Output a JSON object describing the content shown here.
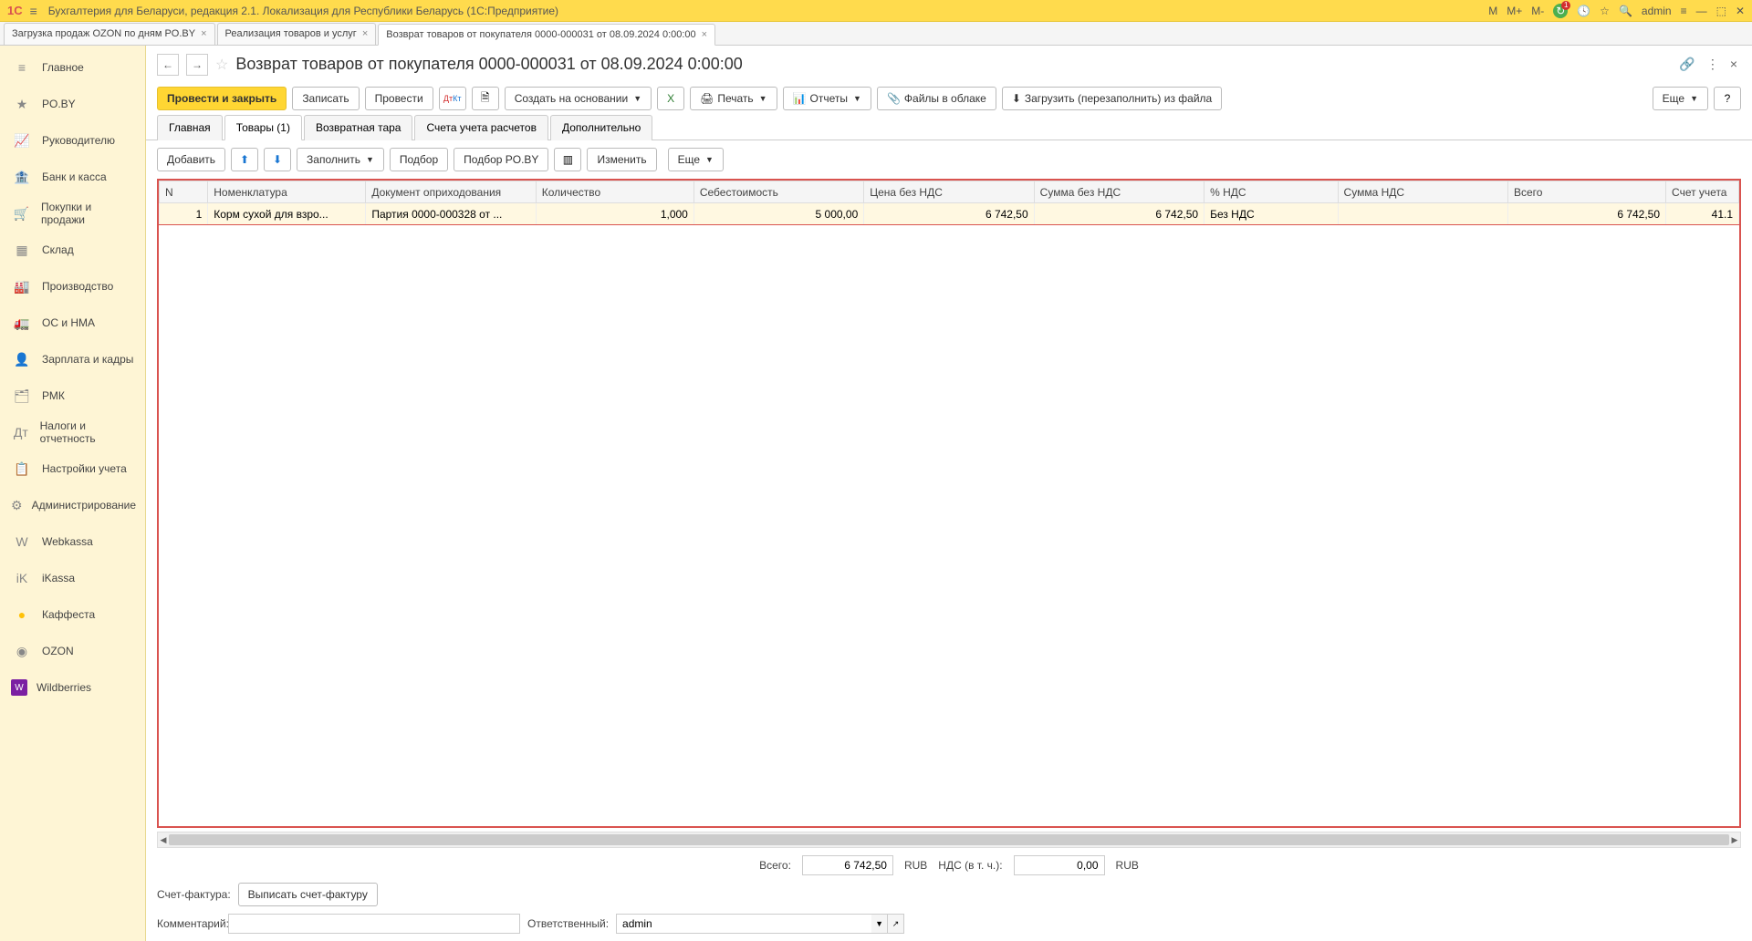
{
  "titlebar": {
    "logo": "1С",
    "title": "Бухгалтерия для Беларуси, редакция 2.1. Локализация для Республики Беларусь  (1С:Предприятие)",
    "m": "M",
    "mplus": "M+",
    "mminus": "M-",
    "user": "admin"
  },
  "doctabs": [
    {
      "label": "Загрузка продаж OZON по дням PO.BY"
    },
    {
      "label": "Реализация товаров и услуг"
    },
    {
      "label": "Возврат товаров от покупателя 0000-000031 от 08.09.2024 0:00:00",
      "active": true
    }
  ],
  "sidebar": [
    {
      "icon": "≡",
      "label": "Главное"
    },
    {
      "icon": "★",
      "label": "PO.BY"
    },
    {
      "icon": "📈",
      "label": "Руководителю"
    },
    {
      "icon": "🏦",
      "label": "Банк и касса"
    },
    {
      "icon": "🛒",
      "label": "Покупки и продажи"
    },
    {
      "icon": "▦",
      "label": "Склад"
    },
    {
      "icon": "🏭",
      "label": "Производство"
    },
    {
      "icon": "🚛",
      "label": "ОС и НМА"
    },
    {
      "icon": "👤",
      "label": "Зарплата и кадры"
    },
    {
      "icon": "🗂",
      "label": "РМК"
    },
    {
      "icon": "Дт",
      "label": "Налоги и отчетность"
    },
    {
      "icon": "📋",
      "label": "Настройки учета"
    },
    {
      "icon": "⚙",
      "label": "Администрирование"
    },
    {
      "icon": "W",
      "label": "Webkassa"
    },
    {
      "icon": "iK",
      "label": "iKassa"
    },
    {
      "icon": "●",
      "label": "Каффеста",
      "kf": true
    },
    {
      "icon": "◉",
      "label": "OZON"
    },
    {
      "icon": "W",
      "label": "Wildberries"
    }
  ],
  "doc": {
    "title": "Возврат товаров от покупателя 0000-000031 от 08.09.2024 0:00:00"
  },
  "toolbar": {
    "postclose": "Провести и закрыть",
    "write": "Записать",
    "post": "Провести",
    "createbase": "Создать на основании",
    "print": "Печать",
    "reports": "Отчеты",
    "files": "Файлы в облаке",
    "load": "Загрузить (перезаполнить) из файла",
    "more": "Еще"
  },
  "sectabs": [
    {
      "label": "Главная"
    },
    {
      "label": "Товары (1)",
      "active": true
    },
    {
      "label": "Возвратная тара"
    },
    {
      "label": "Счета учета расчетов"
    },
    {
      "label": "Дополнительно"
    }
  ],
  "subtoolbar": {
    "add": "Добавить",
    "fill": "Заполнить",
    "select": "Подбор",
    "selectpo": "Подбор PO.BY",
    "change": "Изменить",
    "more": "Еще"
  },
  "table": {
    "headers": [
      "N",
      "Номенклатура",
      "Документ оприходования",
      "Количество",
      "Себестоимость",
      "Цена без НДС",
      "Сумма без НДС",
      "% НДС",
      "Сумма НДС",
      "Всего",
      "Счет учета"
    ],
    "rows": [
      {
        "n": "1",
        "nom": "Корм сухой для взро...",
        "doc": "Партия 0000-000328 от ...",
        "qty": "1,000",
        "cost": "5 000,00",
        "price": "6 742,50",
        "sum": "6 742,50",
        "vat": "Без НДС",
        "vatsum": "",
        "total": "6 742,50",
        "acct": "41.1"
      }
    ]
  },
  "footer": {
    "total_label": "Всего:",
    "total_val": "6 742,50",
    "rub": "RUB",
    "vat_label": "НДС (в т. ч.):",
    "vat_val": "0,00",
    "invoice_label": "Счет-фактура:",
    "invoice_btn": "Выписать счет-фактуру",
    "comment_label": "Комментарий:",
    "resp_label": "Ответственный:",
    "resp_val": "admin"
  }
}
